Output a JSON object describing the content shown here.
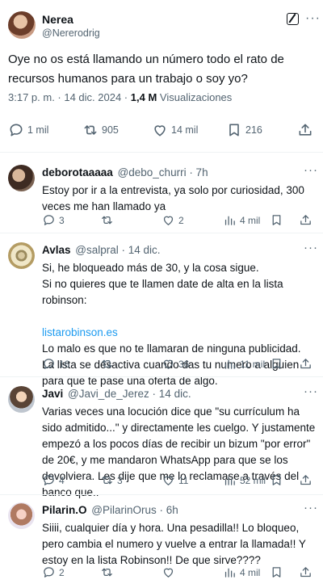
{
  "main_post": {
    "author_name": "Nerea",
    "author_handle": "@Nererodrig",
    "text": "Oye no os está llamando un número todo el rato de recursos humanos para un trabajo o soy yo?",
    "time": "3:17 p. m. · 14 dic. 2024 ·",
    "views_count": "1,4 M",
    "views_label": "Visualizaciones",
    "replies": "1 mil",
    "reposts": "905",
    "likes": "14 mil",
    "bookmarks": "216"
  },
  "replies": [
    {
      "name": "deborotaaaaa",
      "handle": "@debo_churri · 7h",
      "text": [
        "Estoy por ir a la entrevista, ya solo por curiosidad, 300 veces me han llamado ya"
      ],
      "replies": "3",
      "reposts": "",
      "likes": "2",
      "views": "4 mil"
    },
    {
      "name": "Avlas",
      "handle": "@salpral · 14 dic.",
      "text": [
        "Si, he bloqueado más de 30, y la cosa sigue.",
        "Si no quieres que te llamen date de alta en la lista robinson:"
      ],
      "link": "listarobinson.es",
      "text_after": [
        "Lo malo es que no te llamaran de ninguna publicidad.",
        "La lista se desactiva cuando das tu numero a alguien para que te pase una oferta de algo."
      ],
      "replies": "16",
      "reposts": "",
      "likes": "36",
      "views": "11 mil"
    },
    {
      "name": "Javi",
      "handle": "@Javi_de_Jerez · 14 dic.",
      "text": [
        "Varias veces una locución dice que \"su currículum ha sido admitido...\" y directamente les cuelgo. Y justamente empezó a los pocos días de recibir un bizum \"por error\" de 20€, y me mandaron WhatsApp para que se los devolviera. Les dije que me lo reclamase a través del banco que.."
      ],
      "replies": "4",
      "reposts": "3",
      "likes": "11",
      "views": "52 mil"
    },
    {
      "name": "Pilarin.O",
      "handle": "@PilarinOrus · 6h",
      "text": [
        "Siiii, cualquier día y hora. Una pesadilla!! Lo bloqueo, pero cambia el numero y vuelve a entrar la llamada!! Y estoy en la lista Robinson!! De que sirve????"
      ],
      "replies": "2",
      "reposts": "",
      "likes": "",
      "views": "4 mil"
    }
  ],
  "icons": [
    "reply-icon",
    "repost-icon",
    "like-icon",
    "views-icon",
    "bookmark-icon",
    "share-icon",
    "grok-icon",
    "more-icon"
  ]
}
